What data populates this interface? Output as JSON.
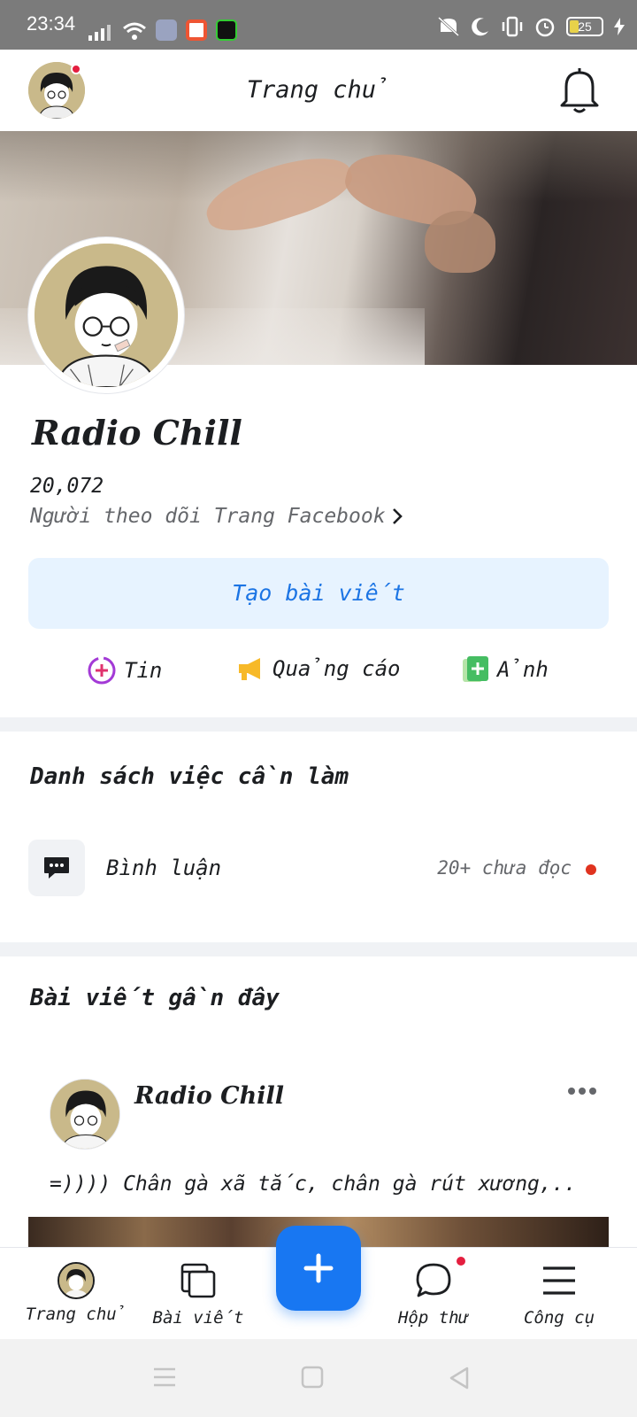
{
  "status_bar": {
    "time": "23:34",
    "battery": "25"
  },
  "header": {
    "title": "Trang chủ"
  },
  "page": {
    "name": "Radio Chill",
    "followers_count": "20,072",
    "followers_label": "Người theo dõi Trang Facebook"
  },
  "actions": {
    "create_post": "Tạo bài viết",
    "story": "Tin",
    "ads": "Quảng cáo",
    "photo": "Ảnh"
  },
  "todo": {
    "title": "Danh sách việc cần làm",
    "comments_label": "Bình luận",
    "comments_status": "20+ chưa đọc"
  },
  "recent_posts": {
    "title": "Bài viết gần đây",
    "post": {
      "author": "Radio Chill",
      "text": "=)))) Chân gà xã tắc, chân gà rút xương,.."
    }
  },
  "bottom_nav": {
    "home": "Trang chủ",
    "posts": "Bài viết",
    "inbox": "Hộp thư",
    "tools": "Công cụ"
  },
  "colors": {
    "accent": "#1877f2",
    "create_post_bg": "#e7f3ff",
    "notification_dot": "#e41e3f"
  }
}
